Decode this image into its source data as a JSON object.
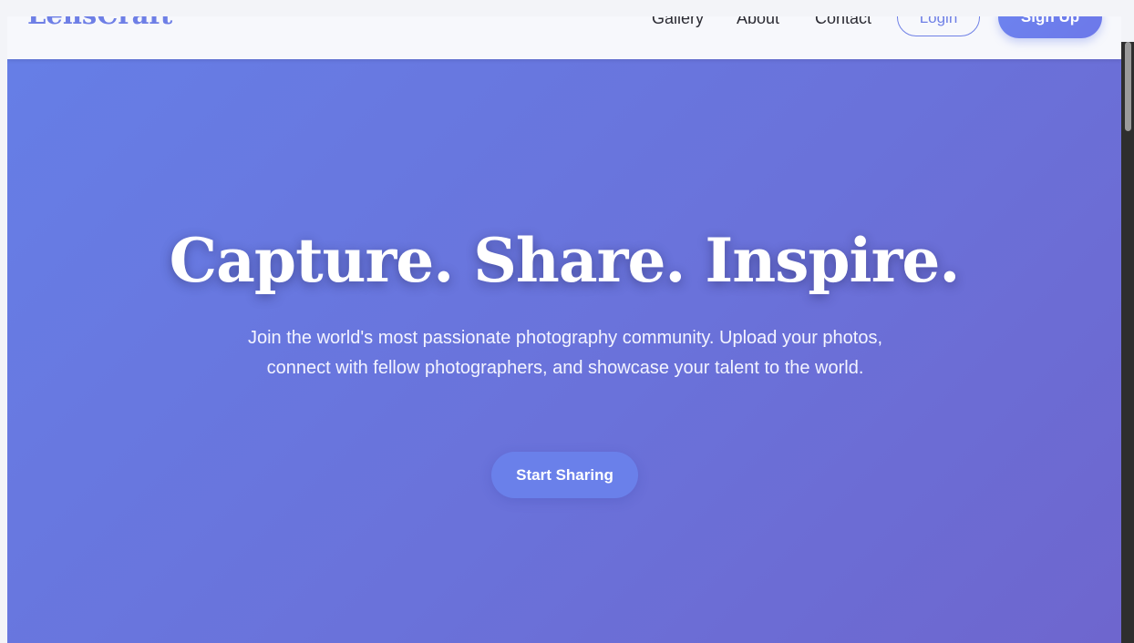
{
  "navbar": {
    "logo": "LensCraft",
    "links": [
      "Gallery",
      "About",
      "Contact"
    ],
    "login_label": "Login",
    "signup_label": "Sign Up"
  },
  "hero": {
    "title": "Capture. Share. Inspire.",
    "description": "Join the world's most passionate photography community. Upload your photos, connect with fellow photographers, and showcase your talent to the world.",
    "cta_label": "Start Sharing"
  },
  "colors": {
    "accent": "#667eea",
    "hero_gradient_end": "#6e66ce",
    "navbar_background": "#f7f8fc"
  }
}
